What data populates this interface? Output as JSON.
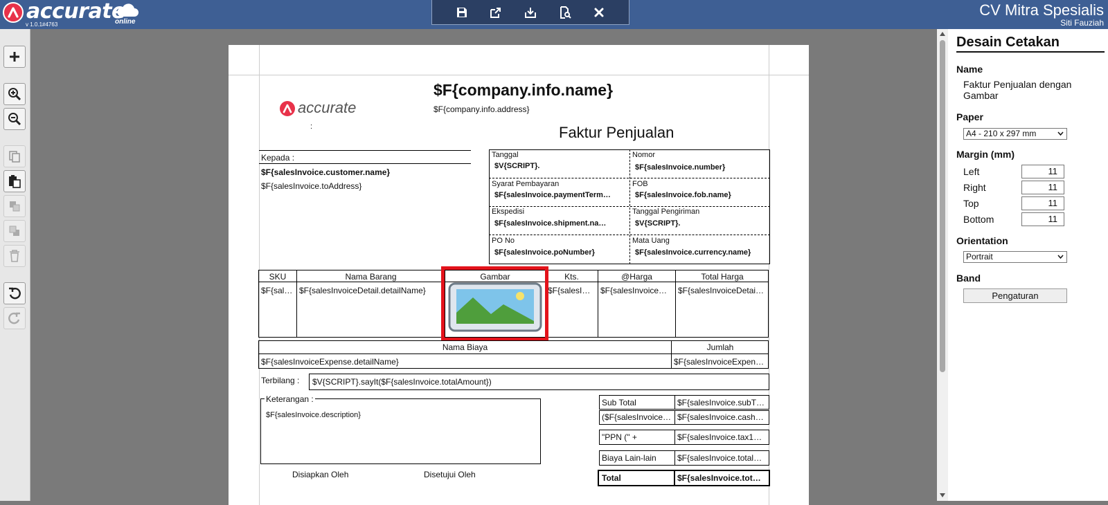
{
  "app": {
    "logo_text": "accurate",
    "logo_sub": "online",
    "version": "v 1.0.1#4763",
    "company_name": "CV Mitra Spesialis",
    "user_name": "Siti Fauziah"
  },
  "toolbar": {
    "icons": [
      "save-icon",
      "export-icon",
      "download-icon",
      "preview-icon",
      "close-icon"
    ]
  },
  "left_tools": {
    "icons": [
      "add-icon",
      "zoom-in-icon",
      "zoom-out-icon",
      "copy-icon",
      "paste-icon",
      "bring-front-icon",
      "send-back-icon",
      "delete-icon",
      "undo-icon",
      "redo-icon"
    ]
  },
  "report": {
    "logo_text": "accurate",
    "company_name": "$F{company.info.name}",
    "company_address": "$F{company.info.address}",
    "colon": ":",
    "title": "Faktur Penjualan",
    "kepada_label": "Kepada :",
    "customer_name": "$F{salesInvoice.customer.name}",
    "to_address": "$F{salesInvoice.toAddress}",
    "info": {
      "tanggal_label": "Tanggal",
      "tanggal_value": "$V{SCRIPT}.",
      "nomor_label": "Nomor",
      "nomor_value": "$F{salesInvoice.number}",
      "syarat_label": "Syarat Pembayaran",
      "syarat_value": "$F{salesInvoice.paymentTerm…",
      "fob_label": "FOB",
      "fob_value": "$F{salesInvoice.fob.name}",
      "ekspedisi_label": "Ekspedisi",
      "ekspedisi_value": "$F{salesInvoice.shipment.na…",
      "tgl_kirim_label": "Tanggal Pengiriman",
      "tgl_kirim_value": "$V{SCRIPT}.",
      "po_label": "PO No",
      "po_value": "$F{salesInvoice.poNumber}",
      "mata_uang_label": "Mata Uang",
      "mata_uang_value": "$F{salesInvoice.currency.name}"
    },
    "detail_headers": [
      "SKU",
      "Nama Barang",
      "Gambar",
      "Kts.",
      "@Harga",
      "Total Harga"
    ],
    "detail_values": [
      "$F{sal…",
      "$F{salesInvoiceDetail.detailName}",
      "",
      "$F{salesI…",
      "$F{salesInvoice…",
      "$F{salesInvoiceDetai…"
    ],
    "expense_headers": [
      "Nama Biaya",
      "Jumlah"
    ],
    "expense_values": [
      "$F{salesInvoiceExpense.detailName}",
      "$F{salesInvoiceExpen…"
    ],
    "terbilang_label": "Terbilang :",
    "terbilang_value": "$V{SCRIPT}.sayIt($F{salesInvoice.totalAmount})",
    "keterangan_label": "Keterangan :",
    "description": "$F{salesInvoice.description}",
    "totals": [
      {
        "label": "Sub Total",
        "value": "$F{salesInvoice.subT…"
      },
      {
        "label": "($F{salesInvoice…",
        "value": "$F{salesInvoice.cash…"
      },
      {
        "label": "\"PPN (\" +",
        "value": "$F{salesInvoice.tax1…"
      },
      {
        "label": "Biaya Lain-lain",
        "value": "$F{salesInvoice.total…"
      },
      {
        "label": "Total",
        "value": "$F{salesInvoice.tot…"
      }
    ],
    "disiapkan": "Disiapkan Oleh",
    "disetujui": "Disetujui Oleh"
  },
  "panel": {
    "title": "Desain Cetakan",
    "name_label": "Name",
    "name_value": "Faktur Penjualan dengan Gambar",
    "paper_label": "Paper",
    "paper_value": "A4 - 210 x 297 mm",
    "margin_label": "Margin (mm)",
    "margins": [
      {
        "label": "Left",
        "value": "11"
      },
      {
        "label": "Right",
        "value": "11"
      },
      {
        "label": "Top",
        "value": "11"
      },
      {
        "label": "Bottom",
        "value": "11"
      }
    ],
    "orientation_label": "Orientation",
    "orientation_value": "Portrait",
    "band_label": "Band",
    "band_button": "Pengaturan"
  },
  "colors": {
    "topbar": "#3e5f94",
    "toolbar": "#2b3f63",
    "brand_red": "#e8324a",
    "selection": "#e3131b"
  }
}
